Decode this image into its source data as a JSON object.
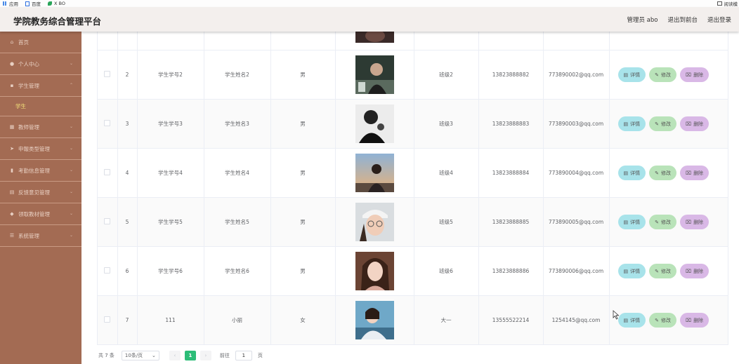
{
  "browser": {
    "bookmarks": [
      {
        "label": "应用",
        "color": "#4a8be8"
      },
      {
        "label": "百度",
        "color": "#2d6fe0"
      },
      {
        "label": "X BO",
        "color": "#2aa55a"
      }
    ],
    "right_label": "阅读模"
  },
  "header": {
    "title": "学院教务综合管理平台",
    "admin": "管理员 abo",
    "front": "退出到前台",
    "logout": "退出登录"
  },
  "sidebar": {
    "items": [
      {
        "label": "首页",
        "icon": "home-icon"
      },
      {
        "label": "个人中心",
        "icon": "user-icon"
      },
      {
        "label": "学生管理",
        "icon": "folder-icon"
      },
      {
        "label": "教师管理",
        "icon": "grid-icon"
      },
      {
        "label": "申報类型管理",
        "icon": "send-icon"
      },
      {
        "label": "考勤信息管理",
        "icon": "chart-icon"
      },
      {
        "label": "反馈意见管理",
        "icon": "list-icon"
      },
      {
        "label": "领取教材管理",
        "icon": "location-icon"
      },
      {
        "label": "系统管理",
        "icon": "menu-icon"
      }
    ],
    "sub_item": "学生"
  },
  "table": {
    "rows": [
      {
        "index": "2",
        "student_no": "学生学号2",
        "name": "学生姓名2",
        "gender": "男",
        "class": "班级2",
        "phone": "13823888882",
        "email": "773890002@qq.com"
      },
      {
        "index": "3",
        "student_no": "学生学号3",
        "name": "学生姓名3",
        "gender": "男",
        "class": "班级3",
        "phone": "13823888883",
        "email": "773890003@qq.com"
      },
      {
        "index": "4",
        "student_no": "学生学号4",
        "name": "学生姓名4",
        "gender": "男",
        "class": "班级4",
        "phone": "13823888884",
        "email": "773890004@qq.com"
      },
      {
        "index": "5",
        "student_no": "学生学号5",
        "name": "学生姓名5",
        "gender": "男",
        "class": "班级5",
        "phone": "13823888885",
        "email": "773890005@qq.com"
      },
      {
        "index": "6",
        "student_no": "学生学号6",
        "name": "学生姓名6",
        "gender": "男",
        "class": "班级6",
        "phone": "13823888886",
        "email": "773890006@qq.com"
      },
      {
        "index": "7",
        "student_no": "111",
        "name": "小丽",
        "gender": "女",
        "class": "大一",
        "phone": "13555522214",
        "email": "1254145@qq.com"
      }
    ],
    "actions": {
      "detail": "详情",
      "edit": "修改",
      "delete": "删除"
    }
  },
  "pager": {
    "total": "共 7 条",
    "page_size": "10条/页",
    "current": "1",
    "goto_label": "前往",
    "goto_value": "1",
    "page_unit": "页"
  }
}
